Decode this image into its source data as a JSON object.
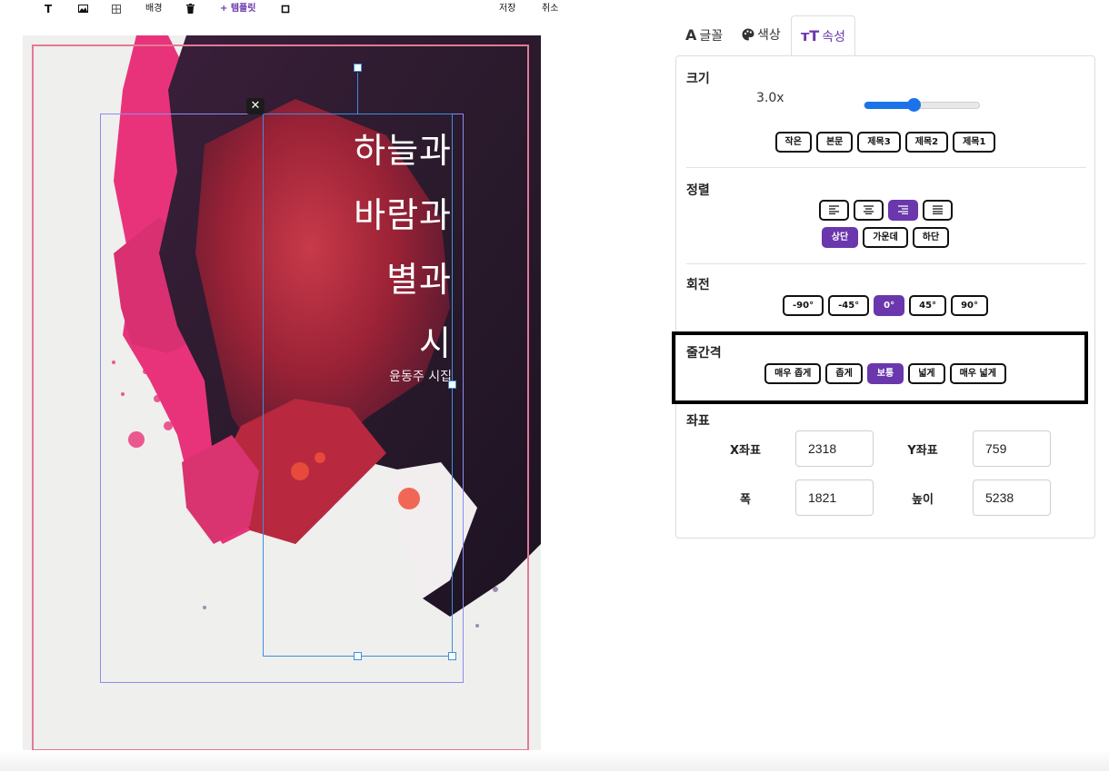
{
  "toolbar": {
    "text_icon": "T",
    "image_icon": "image-icon",
    "grid_icon": "grid-icon",
    "background": "배경",
    "trash_icon": "trash-icon",
    "template": "+ 템플릿",
    "frame_icon": "frame-icon",
    "save": "저장",
    "cancel": "취소"
  },
  "canvas": {
    "close_glyph": "✕",
    "poem_lines": [
      "하늘과",
      "바람과",
      "별과",
      "시"
    ],
    "subtitle": "윤동주 시집",
    "colors": {
      "frame": "#e27a96",
      "selection_outer": "#8b8ef0",
      "selection_inner": "#3b8fe0"
    }
  },
  "tabs": [
    {
      "icon": "A",
      "label": "글꼴",
      "active": false
    },
    {
      "icon": "palette-icon",
      "label": "색상",
      "active": false
    },
    {
      "icon": "ᴛT",
      "label": "속성",
      "active": true
    }
  ],
  "panel": {
    "size": {
      "title": "크기",
      "value": "3.0x",
      "slider_fraction": 0.43,
      "presets": [
        "작은",
        "본문",
        "제목3",
        "제목2",
        "제목1"
      ]
    },
    "align": {
      "title": "정렬",
      "horizontal": [
        "left",
        "center",
        "right",
        "justify"
      ],
      "horizontal_active": 2,
      "vertical": [
        "상단",
        "가운데",
        "하단"
      ],
      "vertical_active": 0
    },
    "rotation": {
      "title": "회전",
      "options": [
        "-90°",
        "-45°",
        "0°",
        "45°",
        "90°"
      ],
      "active": 2
    },
    "line_spacing": {
      "title": "줄간격",
      "options": [
        "매우 좁게",
        "좁게",
        "보통",
        "넓게",
        "매우 넓게"
      ],
      "active": 2
    },
    "coords": {
      "title": "좌표",
      "x_label": "X좌표",
      "x_value": "2318",
      "y_label": "Y좌표",
      "y_value": "759",
      "w_label": "폭",
      "w_value": "1821",
      "h_label": "높이",
      "h_value": "5238"
    }
  },
  "accent_color": "#6a37ad"
}
